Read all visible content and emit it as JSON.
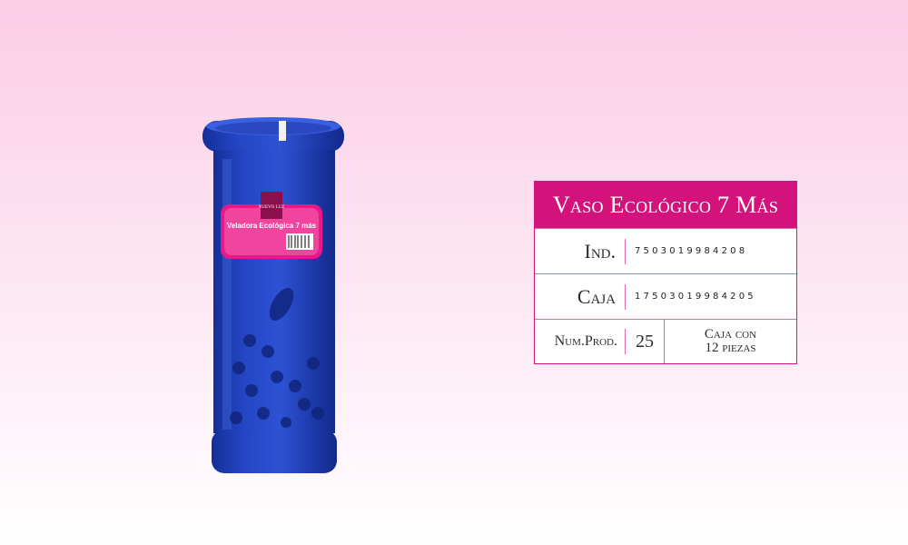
{
  "product": {
    "title": "Vaso Ecológico 7 Más",
    "label_title": "Veladora Ecológica 7 más",
    "logo_text": "NUEVO LUZ",
    "fields": [
      {
        "label": "Ind.",
        "value": "7503019984208"
      },
      {
        "label": "Caja",
        "value": "17503019984205"
      }
    ],
    "num_prod_label": "Num.Prod.",
    "num_prod_value": "25",
    "pack_line1": "Caja con",
    "pack_line2": "12 piezas"
  },
  "colors": {
    "magenta": "#d3127c",
    "glass_blue": "#1f3fb8",
    "background_top": "#fbcde6"
  }
}
